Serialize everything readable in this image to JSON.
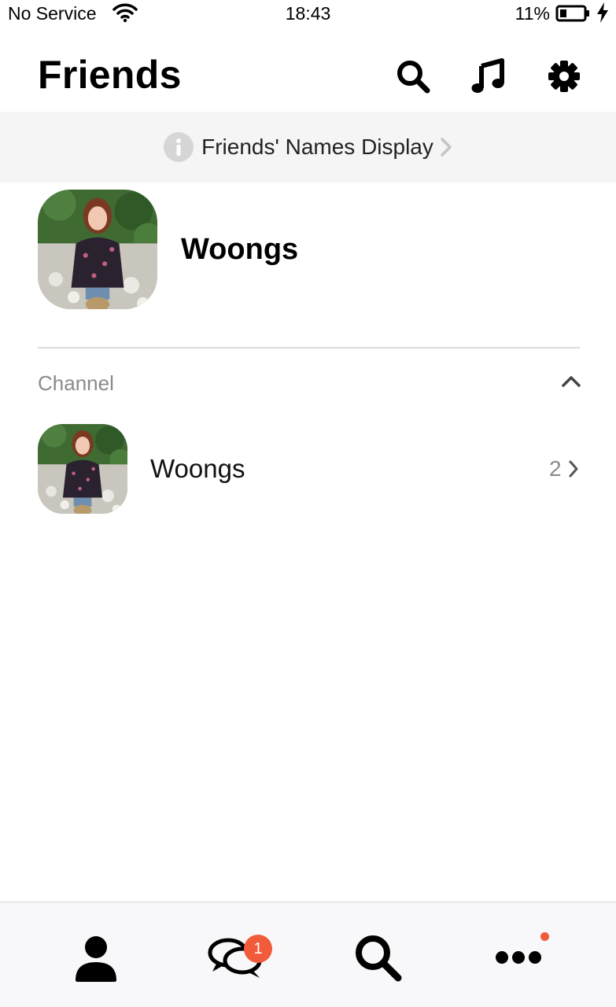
{
  "status_bar": {
    "carrier": "No Service",
    "time": "18:43",
    "battery_percent": "11%",
    "battery_level": 0.11,
    "wifi_icon": "wifi-icon",
    "battery_icon": "battery-icon",
    "charging_icon": "bolt-icon"
  },
  "header": {
    "title": "Friends",
    "icons": [
      "search-icon",
      "music-note-icon",
      "gear-icon"
    ]
  },
  "banner": {
    "text": "Friends' Names Display",
    "icon": "info-icon"
  },
  "profile": {
    "name": "Woongs",
    "avatar": "avatar-photo"
  },
  "channel_section": {
    "title": "Channel",
    "toggle_icon": "chevron-up-icon",
    "items": [
      {
        "name": "Woongs",
        "count": "2",
        "avatar": "avatar-photo"
      }
    ]
  },
  "bottom_nav": {
    "items": [
      {
        "icon": "person-icon"
      },
      {
        "icon": "chat-bubbles-icon",
        "badge": "1"
      },
      {
        "icon": "search-icon"
      },
      {
        "icon": "more-dots-icon",
        "notification_dot": true
      }
    ]
  },
  "colors": {
    "badge": "#f15a3a",
    "banner_bg": "#f5f5f5",
    "secondary_text": "#8a8a8a",
    "nav_bg": "#f8f8fa"
  }
}
